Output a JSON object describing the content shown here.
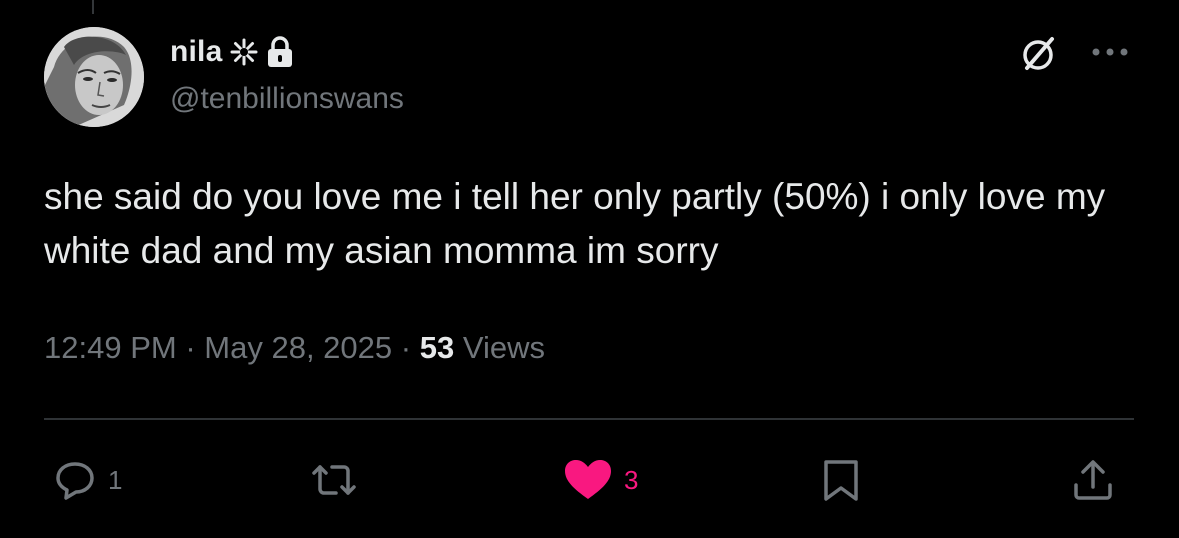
{
  "user": {
    "display_name": "nila",
    "handle": "@tenbillionswans",
    "avatar_alt": "profile photo",
    "name_icons": [
      "sparkle-icon",
      "lock-icon"
    ]
  },
  "header_actions": {
    "grok_icon": "grok-icon",
    "more_icon": "more-dots-icon"
  },
  "tweet": {
    "text": "she said do you love me i tell her only partly (50%) i only love my white dad and my asian momma im sorry"
  },
  "meta": {
    "time": "12:49 PM",
    "separator": "·",
    "date": "May 28, 2025",
    "views_count": "53",
    "views_label": "Views"
  },
  "actions": {
    "reply": {
      "icon": "reply-icon",
      "count": "1"
    },
    "retweet": {
      "icon": "retweet-icon",
      "count": ""
    },
    "like": {
      "icon": "heart-icon",
      "count": "3",
      "active": true
    },
    "bookmark": {
      "icon": "bookmark-icon"
    },
    "share": {
      "icon": "share-icon"
    }
  },
  "colors": {
    "background": "#000000",
    "primary_text": "#e7e9ea",
    "secondary_text": "#71767b",
    "like_pink": "#f91880",
    "divider": "#2f3336"
  }
}
